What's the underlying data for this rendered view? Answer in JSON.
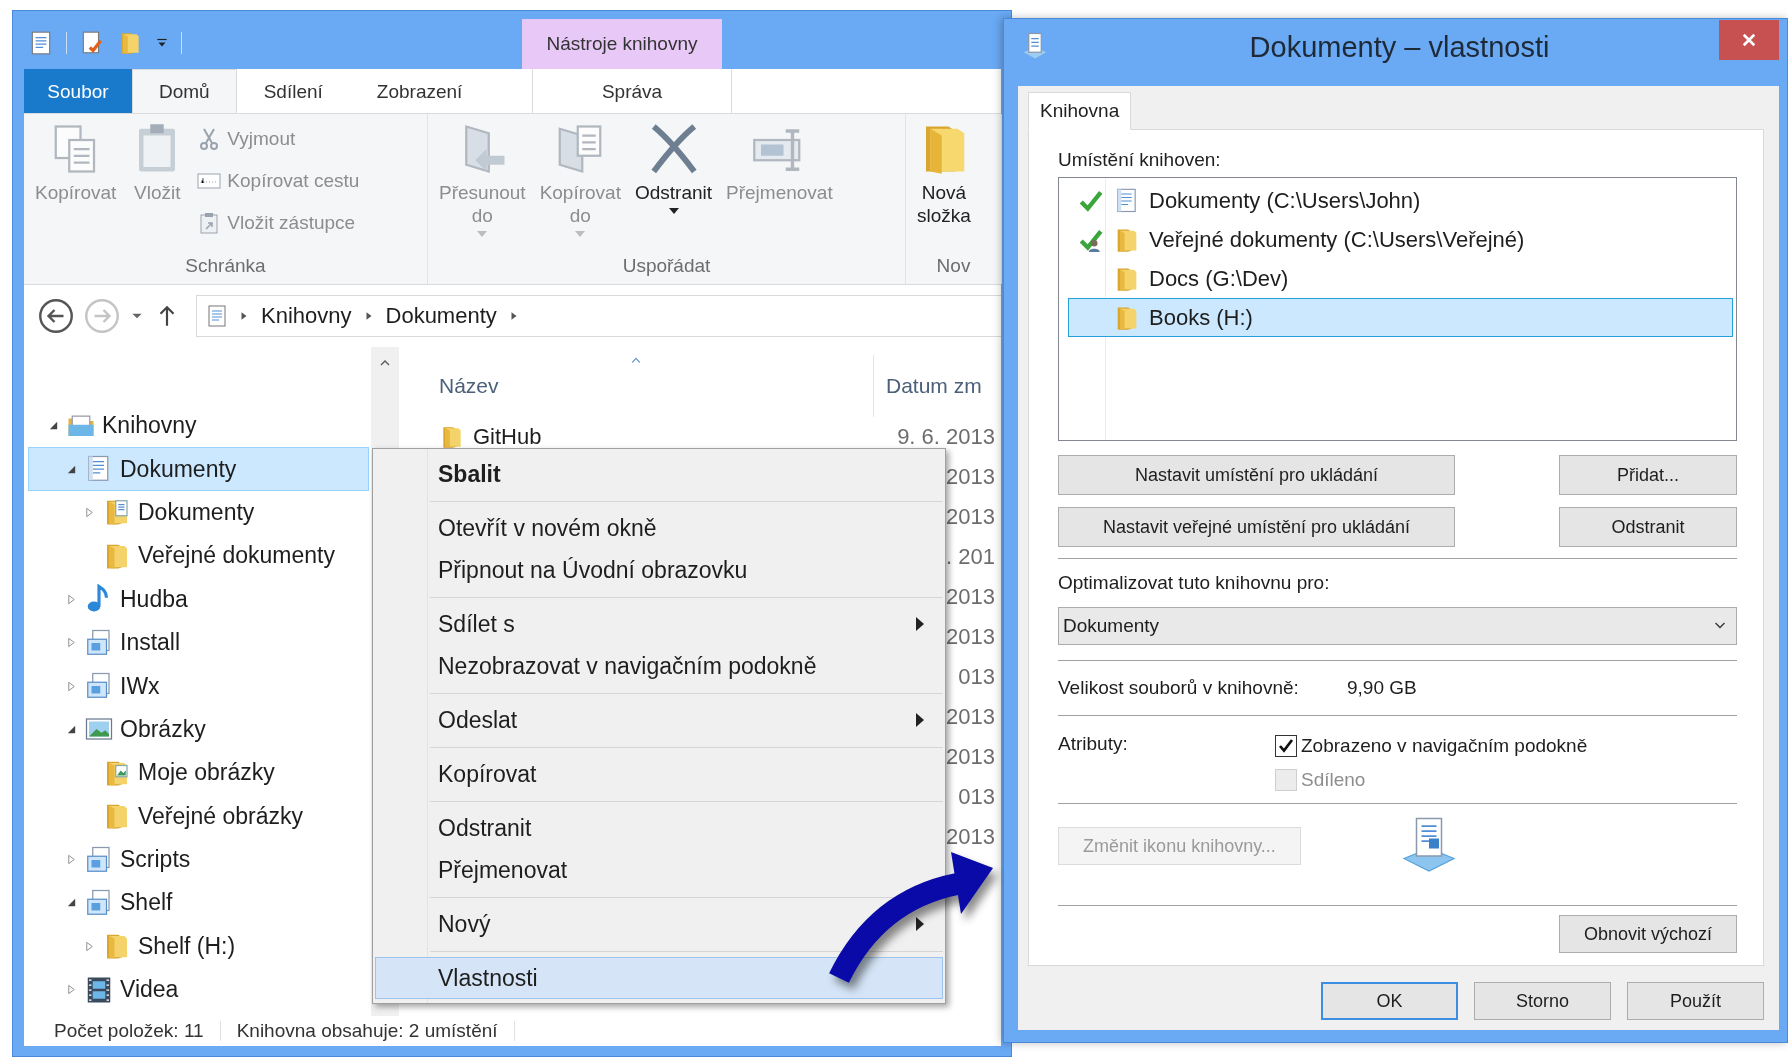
{
  "explorer": {
    "contextual_group": "Nástroje knihovny",
    "ribbon_tabs": [
      {
        "label": "Soubor",
        "kind": "file",
        "selected": false
      },
      {
        "label": "Domů",
        "kind": "tab",
        "selected": true
      },
      {
        "label": "Sdílení",
        "kind": "tab",
        "selected": false
      },
      {
        "label": "Zobrazení",
        "kind": "tab",
        "selected": false
      },
      {
        "label": "Správa",
        "kind": "contextual",
        "selected": false
      }
    ],
    "ribbon_groups": [
      {
        "title": "Schránka",
        "commands": [
          {
            "label": "Kopírovat",
            "kind": "large",
            "disabled": true,
            "dropdown": false
          },
          {
            "label": "Vložit",
            "kind": "large",
            "disabled": true,
            "dropdown": false
          },
          {
            "label": "Vyjmout",
            "kind": "small",
            "disabled": true
          },
          {
            "label": "Kopírovat cestu",
            "kind": "small",
            "disabled": true
          },
          {
            "label": "Vložit zástupce",
            "kind": "small",
            "disabled": true
          }
        ]
      },
      {
        "title": "Uspořádat",
        "commands": [
          {
            "label": "Přesunout do",
            "kind": "large",
            "disabled": true,
            "dropdown": true
          },
          {
            "label": "Kopírovat do",
            "kind": "large",
            "disabled": true,
            "dropdown": true
          },
          {
            "label": "Odstranit",
            "kind": "large",
            "disabled": false,
            "dropdown": true
          },
          {
            "label": "Přejmenovat",
            "kind": "large",
            "disabled": true,
            "dropdown": false
          }
        ]
      },
      {
        "title": "Nov",
        "commands": [
          {
            "label": "Nová složka",
            "kind": "large",
            "disabled": false,
            "dropdown": false
          }
        ]
      }
    ],
    "breadcrumbs": [
      "Knihovny",
      "Dokumenty"
    ],
    "tree": [
      {
        "label": "Knihovny",
        "kind": "libraries",
        "expanded": true,
        "selected": false,
        "children": [
          {
            "label": "Dokumenty",
            "kind": "documents",
            "expanded": true,
            "selected": true,
            "children": [
              {
                "label": "Dokumenty",
                "kind": "doc-folder",
                "expanded": false,
                "selected": false
              },
              {
                "label": "Veřejné dokumenty",
                "kind": "folder",
                "selected": false
              }
            ]
          },
          {
            "label": "Hudba",
            "kind": "music",
            "expanded": false,
            "selected": false
          },
          {
            "label": "Install",
            "kind": "library",
            "expanded": false,
            "selected": false
          },
          {
            "label": "IWx",
            "kind": "library",
            "expanded": false,
            "selected": false
          },
          {
            "label": "Obrázky",
            "kind": "pictures",
            "expanded": true,
            "selected": false,
            "children": [
              {
                "label": "Moje obrázky",
                "kind": "pic-folder",
                "selected": false
              },
              {
                "label": "Veřejné obrázky",
                "kind": "folder",
                "selected": false
              }
            ]
          },
          {
            "label": "Scripts",
            "kind": "library",
            "expanded": false,
            "selected": false
          },
          {
            "label": "Shelf",
            "kind": "library",
            "expanded": true,
            "selected": false,
            "children": [
              {
                "label": "Shelf (H:)",
                "kind": "folder",
                "expanded": false,
                "selected": false
              }
            ]
          },
          {
            "label": "Videa",
            "kind": "videos",
            "expanded": false,
            "selected": false
          }
        ]
      }
    ],
    "columns": [
      {
        "label": "Název",
        "sorted": true
      },
      {
        "label": "Datum zm",
        "sorted": false
      }
    ],
    "files": [
      {
        "name": "GitHub",
        "date": "9. 6. 2013"
      },
      {
        "date": "2013"
      },
      {
        "date": "2013"
      },
      {
        "date": ". 201"
      },
      {
        "date": "2013"
      },
      {
        "date": "2013"
      },
      {
        "date": "013"
      },
      {
        "date": "2013"
      },
      {
        "date": "2013"
      },
      {
        "date": "013"
      },
      {
        "date": "2013"
      }
    ],
    "status": [
      "Počet položek: 11",
      "Knihovna obsahuje: 2 umístění"
    ]
  },
  "context_menu": {
    "sections": [
      [
        {
          "label": "Sbalit",
          "default": true,
          "submenu": false,
          "selected": false
        }
      ],
      [
        {
          "label": "Otevřít v novém okně",
          "default": false,
          "submenu": false,
          "selected": false
        },
        {
          "label": "Připnout na Úvodní obrazovku",
          "default": false,
          "submenu": false,
          "selected": false
        }
      ],
      [
        {
          "label": "Sdílet s",
          "default": false,
          "submenu": true,
          "selected": false
        },
        {
          "label": "Nezobrazovat v navigačním podokně",
          "default": false,
          "submenu": false,
          "selected": false
        }
      ],
      [
        {
          "label": "Odeslat",
          "default": false,
          "submenu": true,
          "selected": false
        }
      ],
      [
        {
          "label": "Kopírovat",
          "default": false,
          "submenu": false,
          "selected": false
        }
      ],
      [
        {
          "label": "Odstranit",
          "default": false,
          "submenu": false,
          "selected": false
        },
        {
          "label": "Přejmenovat",
          "default": false,
          "submenu": false,
          "selected": false
        }
      ],
      [
        {
          "label": "Nový",
          "default": false,
          "submenu": true,
          "selected": false
        }
      ],
      [
        {
          "label": "Vlastnosti",
          "default": false,
          "submenu": false,
          "selected": true
        }
      ]
    ]
  },
  "dialog": {
    "title": "Dokumenty – vlastnosti",
    "tabs": [
      {
        "label": "Knihovna",
        "selected": true
      }
    ],
    "locations_label": "Umístění knihoven:",
    "locations": [
      {
        "path": "Dokumenty (C:\\Users\\John)",
        "kind": "documents",
        "default_save": true,
        "public_save": false,
        "selected": false
      },
      {
        "path": "Veřejné dokumenty (C:\\Users\\Veřejné)",
        "kind": "folder",
        "default_save": false,
        "public_save": true,
        "selected": false
      },
      {
        "path": "Docs (G:\\Dev)",
        "kind": "folder",
        "default_save": false,
        "public_save": false,
        "selected": false
      },
      {
        "path": "Books (H:)",
        "kind": "folder",
        "default_save": false,
        "public_save": false,
        "selected": true
      }
    ],
    "location_buttons": [
      "Nastavit umístění pro ukládání",
      "Přidat...",
      "Nastavit veřejné umístění pro ukládání",
      "Odstranit"
    ],
    "optimize_label": "Optimalizovat tuto knihovnu pro:",
    "optimize_value": "Dokumenty",
    "size_label": "Velikost souborů v knihovně:",
    "size_value": "9,90 GB",
    "attributes_label": "Atributy:",
    "attributes": [
      {
        "label": "Zobrazeno v navigačním podokně",
        "checked": true,
        "disabled": false
      },
      {
        "label": "Sdíleno",
        "checked": false,
        "disabled": true
      }
    ],
    "change_icon": {
      "label": "Změnit ikonu knihovny...",
      "disabled": true
    },
    "restore": "Obnovit výchozí",
    "footer_buttons": [
      {
        "label": "OK",
        "default": true
      },
      {
        "label": "Storno",
        "default": false
      },
      {
        "label": "Použít",
        "default": false
      }
    ]
  }
}
